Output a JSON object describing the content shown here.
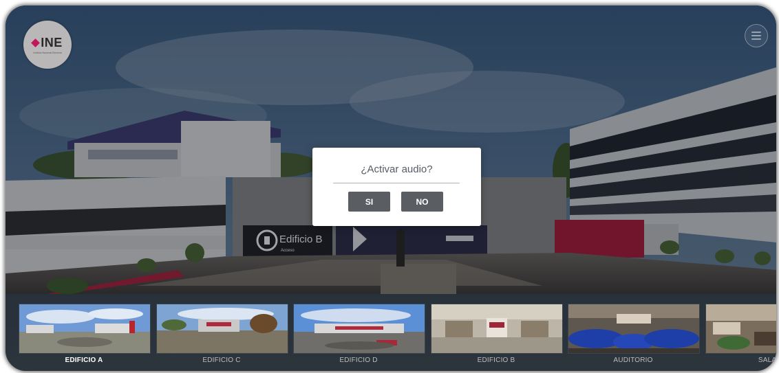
{
  "logo": {
    "brand": "INE",
    "subtitle": "Instituto Nacional Electoral"
  },
  "icons": {
    "menu": "hamburger-menu-icon",
    "logo": "ine-diamond-icon"
  },
  "scene": {
    "signage": "Edificio B",
    "signage_sub": "Acceso"
  },
  "modal": {
    "title": "¿Activar audio?",
    "yes_label": "SI",
    "no_label": "NO"
  },
  "thumbnails": [
    {
      "label": "EDIFICIO A",
      "active": true
    },
    {
      "label": "EDIFICIO C",
      "active": false
    },
    {
      "label": "EDIFICIO D",
      "active": false
    },
    {
      "label": "EDIFICIO B",
      "active": false
    },
    {
      "label": "AUDITORIO",
      "active": false
    },
    {
      "label": "SALA C",
      "active": false
    }
  ],
  "colors": {
    "brand_magenta": "#c2185b",
    "button_gray": "#5a5e63",
    "auditorium_blue": "#1f3fa8"
  }
}
